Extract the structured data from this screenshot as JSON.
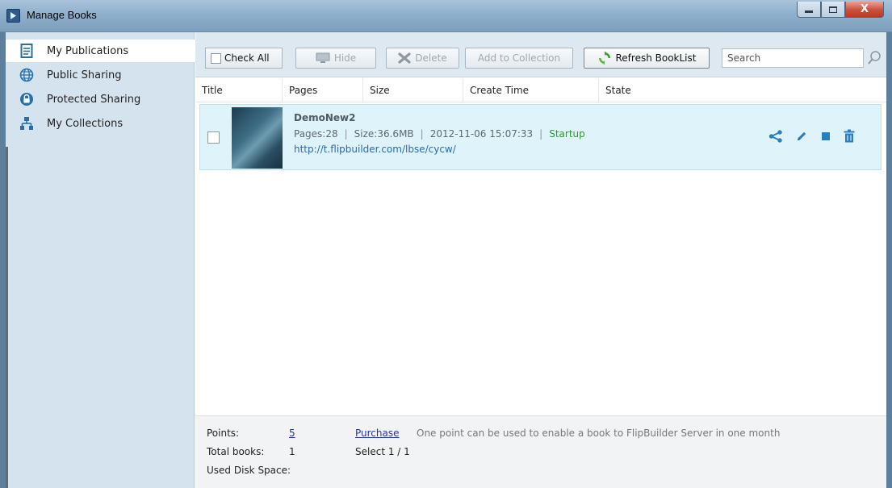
{
  "window": {
    "title": "Manage Books",
    "close_label": "X"
  },
  "sidebar": {
    "items": [
      {
        "label": "My Publications",
        "icon": "document-icon"
      },
      {
        "label": "Public Sharing",
        "icon": "globe-icon"
      },
      {
        "label": "Protected Sharing",
        "icon": "lock-icon"
      },
      {
        "label": "My Collections",
        "icon": "hierarchy-icon"
      }
    ]
  },
  "toolbar": {
    "check_all": "Check All",
    "hide": "Hide",
    "delete": "Delete",
    "add_to_collection": "Add to Collection",
    "refresh": "Refresh BookList",
    "search_placeholder": "Search"
  },
  "columns": [
    "Title",
    "Pages",
    "Size",
    "Create Time",
    "State"
  ],
  "books": [
    {
      "title": "DemoNew2",
      "pages": "Pages:28",
      "size": "Size:36.6MB",
      "create_time": "2012-11-06 15:07:33",
      "state": "Startup",
      "url": "http://t.flipbuilder.com/lbse/cycw/"
    }
  ],
  "footer": {
    "points_label": "Points:",
    "points_value": "5",
    "purchase": "Purchase",
    "note": "One point can be used to enable a book to FlipBuilder Server in one month",
    "total_books_label": "Total books:",
    "total_books_value": "1",
    "select": "Select 1 / 1",
    "disk_label": "Used Disk Space:"
  },
  "colors": {
    "sidebar_bg": "#d5e3ef",
    "toolbar_bg": "#dde8f1",
    "row_bg": "#dff3fb",
    "state_green": "#2f9a2f",
    "action_blue": "#2a7fc2",
    "link": "#2b6aa8"
  }
}
